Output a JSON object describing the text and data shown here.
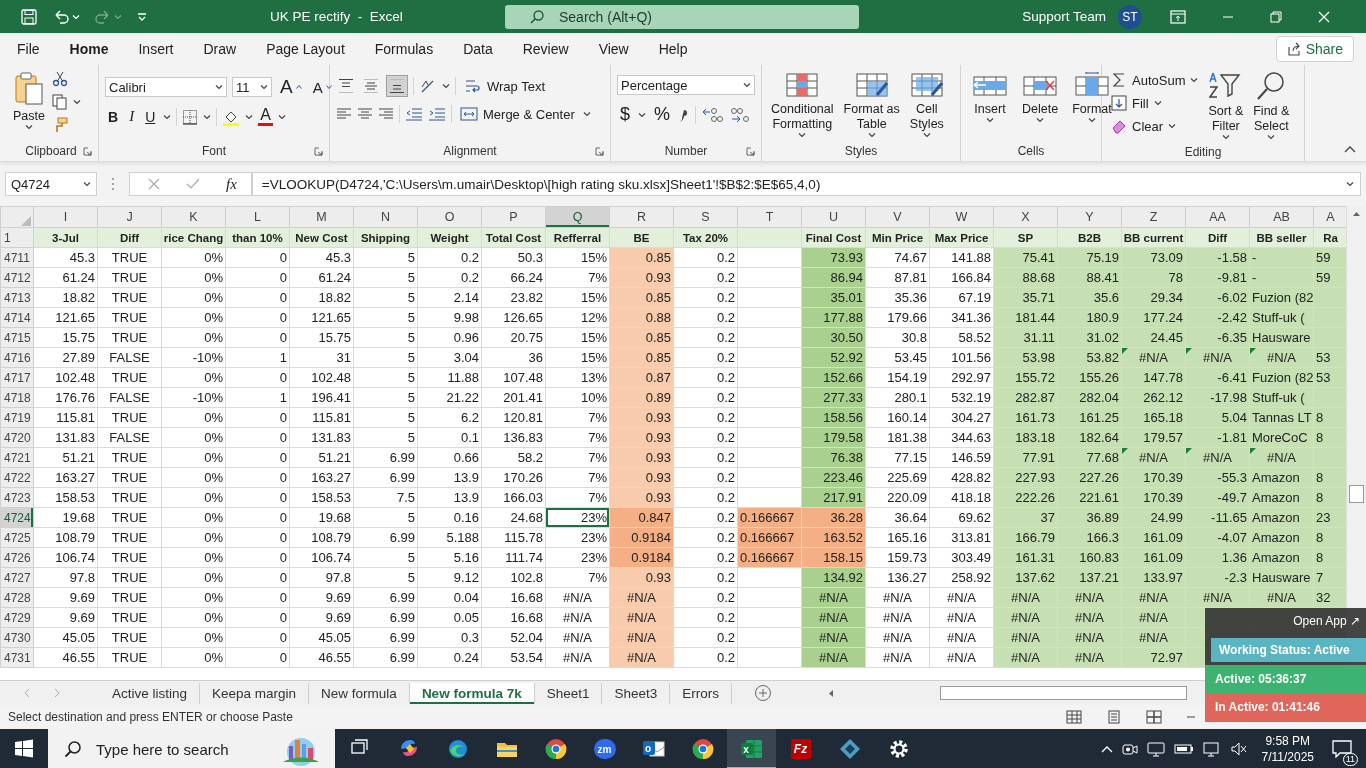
{
  "window": {
    "title": "UK PE rectify  -  Excel",
    "search_placeholder": "Search (Alt+Q)",
    "user_name": "Support Team",
    "avatar": "ST"
  },
  "quick_access": [
    {
      "kind": "save",
      "disabled": false
    },
    {
      "kind": "undo",
      "disabled": false
    },
    {
      "kind": "redo",
      "disabled": true
    },
    {
      "kind": "customize",
      "disabled": false
    }
  ],
  "menu_tabs": [
    {
      "label": "File",
      "selected": false
    },
    {
      "label": "Home",
      "selected": true
    },
    {
      "label": "Insert",
      "selected": false
    },
    {
      "label": "Draw",
      "selected": false
    },
    {
      "label": "Page Layout",
      "selected": false
    },
    {
      "label": "Formulas",
      "selected": false
    },
    {
      "label": "Data",
      "selected": false
    },
    {
      "label": "Review",
      "selected": false
    },
    {
      "label": "View",
      "selected": false
    },
    {
      "label": "Help",
      "selected": false
    }
  ],
  "share": "Share",
  "ribbon": {
    "clipboard": {
      "paste": "Paste",
      "label": "Clipboard"
    },
    "font": {
      "name": "Calibri",
      "size": "11",
      "grow": "A",
      "shrink": "A",
      "bold": "B",
      "italic": "I",
      "underline": "U",
      "font_color": "A",
      "label": "Font"
    },
    "alignment": {
      "vertical_align": [
        {
          "kind": "top",
          "selected": false
        },
        {
          "kind": "middle",
          "selected": false
        },
        {
          "kind": "bottom",
          "selected": true
        }
      ],
      "wrap": "Wrap Text",
      "merge": "Merge & Center",
      "label": "Alignment"
    },
    "number": {
      "format": "Percentage",
      "currency": "$",
      "percent": "%",
      "label": "Number"
    },
    "styles": {
      "conditional": "Conditional\nFormatting",
      "format_table": "Format as\nTable",
      "cell_styles": "Cell\nStyles",
      "label": "Styles"
    },
    "cells": {
      "insert": "Insert",
      "delete": "Delete",
      "format": "Format",
      "label": "Cells"
    },
    "editing": {
      "autosum": "AutoSum",
      "fill": "Fill",
      "clear": "Clear",
      "sort": "Sort &\nFilter",
      "find": "Find &\nSelect",
      "label": "Editing"
    }
  },
  "formula_bar": {
    "name_box": "Q4724",
    "function_label": "fx",
    "formula": "=VLOOKUP(D4724,'C:\\Users\\m.umair\\Desktop\\[high rating sku.xlsx]Sheet1'!$B$2:$E$65,4,0)"
  },
  "grid": {
    "header_row": "1",
    "columns": [
      {
        "letter": "I",
        "title": "3-Jul",
        "kind": "number",
        "selected": false
      },
      {
        "letter": "J",
        "title": "Diff",
        "kind": "boolean",
        "selected": false
      },
      {
        "letter": "K",
        "title": "rice Chang",
        "kind": "number",
        "selected": false
      },
      {
        "letter": "L",
        "title": "than 10%",
        "kind": "number",
        "selected": false
      },
      {
        "letter": "M",
        "title": "New Cost",
        "kind": "number",
        "selected": false
      },
      {
        "letter": "N",
        "title": "Shipping",
        "kind": "number",
        "selected": false
      },
      {
        "letter": "O",
        "title": "Weight",
        "kind": "number",
        "selected": false
      },
      {
        "letter": "P",
        "title": "Total Cost",
        "kind": "number",
        "selected": false
      },
      {
        "letter": "Q",
        "title": "Refferral",
        "kind": "number",
        "selected": true
      },
      {
        "letter": "R",
        "title": "BE",
        "kind": "number",
        "selected": false,
        "color": "#f8cbad",
        "flaggable": true
      },
      {
        "letter": "S",
        "title": "Tax 20%",
        "kind": "number",
        "selected": false
      },
      {
        "letter": "T",
        "kind": "text",
        "selected": false,
        "flaggable": true
      },
      {
        "letter": "U",
        "title": "Final Cost",
        "kind": "number",
        "selected": false,
        "color": "#a9d08e",
        "flaggable": true
      },
      {
        "letter": "V",
        "title": "Min Price",
        "kind": "number",
        "selected": false
      },
      {
        "letter": "W",
        "title": "Max Price",
        "kind": "number",
        "selected": false
      },
      {
        "letter": "X",
        "title": "SP",
        "kind": "number",
        "selected": false,
        "color": "#c6e0b4"
      },
      {
        "letter": "Y",
        "title": "B2B",
        "kind": "number",
        "selected": false,
        "color": "#c6e0b4"
      },
      {
        "letter": "Z",
        "title": "BB current",
        "kind": "number",
        "selected": false,
        "color": "#c6e0b4",
        "error_marks": true
      },
      {
        "letter": "AA",
        "title": "Diff",
        "kind": "number",
        "selected": false,
        "color": "#c6e0b4",
        "error_marks": true
      },
      {
        "letter": "AB",
        "title": "BB seller",
        "kind": "text",
        "selected": false,
        "color": "#c6e0b4",
        "error_marks": true
      },
      {
        "letter": "A",
        "title": "Ra",
        "kind": "text",
        "selected": false,
        "color": "#c6e0b4"
      }
    ],
    "rows": [
      {
        "number": "4711",
        "selected": false,
        "flagged": false,
        "error_marks": false,
        "cells": [
          "45.3",
          "TRUE",
          "0%",
          "0",
          "45.3",
          "5",
          "0.2",
          "50.3",
          "15%",
          "0.85",
          "0.2",
          null,
          "73.93",
          "74.67",
          "141.88",
          "75.41",
          "75.19",
          "73.09",
          "-1.58",
          "-",
          "59"
        ]
      },
      {
        "number": "4712",
        "selected": false,
        "flagged": false,
        "error_marks": false,
        "cells": [
          "61.24",
          "TRUE",
          "0%",
          "0",
          "61.24",
          "5",
          "0.2",
          "66.24",
          "7%",
          "0.93",
          "0.2",
          null,
          "86.94",
          "87.81",
          "166.84",
          "88.68",
          "88.41",
          "78",
          "-9.81",
          "-",
          "59"
        ]
      },
      {
        "number": "4713",
        "selected": false,
        "flagged": false,
        "error_marks": false,
        "cells": [
          "18.82",
          "TRUE",
          "0%",
          "0",
          "18.82",
          "5",
          "2.14",
          "23.82",
          "15%",
          "0.85",
          "0.2",
          null,
          "35.01",
          "35.36",
          "67.19",
          "35.71",
          "35.6",
          "29.34",
          "-6.02",
          "Fuzion (82",
          null
        ]
      },
      {
        "number": "4714",
        "selected": false,
        "flagged": false,
        "error_marks": false,
        "cells": [
          "121.65",
          "TRUE",
          "0%",
          "0",
          "121.65",
          "5",
          "9.98",
          "126.65",
          "12%",
          "0.88",
          "0.2",
          null,
          "177.88",
          "179.66",
          "341.36",
          "181.44",
          "180.9",
          "177.24",
          "-2.42",
          "Stuff-uk (",
          null
        ]
      },
      {
        "number": "4715",
        "selected": false,
        "flagged": false,
        "error_marks": false,
        "cells": [
          "15.75",
          "TRUE",
          "0%",
          "0",
          "15.75",
          "5",
          "0.96",
          "20.75",
          "15%",
          "0.85",
          "0.2",
          null,
          "30.50",
          "30.8",
          "58.52",
          "31.11",
          "31.02",
          "24.45",
          "-6.35",
          "Hausware",
          null
        ]
      },
      {
        "number": "4716",
        "selected": false,
        "flagged": false,
        "error_marks": true,
        "cells": [
          "27.89",
          "FALSE",
          "-10%",
          "1",
          "31",
          "5",
          "3.04",
          "36",
          "15%",
          "0.85",
          "0.2",
          null,
          "52.92",
          "53.45",
          "101.56",
          "53.98",
          "53.82",
          {
            "text": "#N/A",
            "kind": "error"
          },
          {
            "text": "#N/A",
            "kind": "error"
          },
          {
            "text": "#N/A",
            "kind": "error"
          },
          "53"
        ]
      },
      {
        "number": "4717",
        "selected": false,
        "flagged": false,
        "error_marks": false,
        "cells": [
          "102.48",
          "TRUE",
          "0%",
          "0",
          "102.48",
          "5",
          "11.88",
          "107.48",
          "13%",
          "0.87",
          "0.2",
          null,
          "152.66",
          "154.19",
          "292.97",
          "155.72",
          "155.26",
          "147.78",
          "-6.41",
          "Fuzion (82",
          "53"
        ]
      },
      {
        "number": "4718",
        "selected": false,
        "flagged": false,
        "error_marks": false,
        "cells": [
          "176.76",
          "FALSE",
          "-10%",
          "1",
          "196.41",
          "5",
          "21.22",
          "201.41",
          "10%",
          "0.89",
          "0.2",
          null,
          "277.33",
          "280.1",
          "532.19",
          "282.87",
          "282.04",
          "262.12",
          "-17.98",
          "Stuff-uk (",
          null
        ]
      },
      {
        "number": "4719",
        "selected": false,
        "flagged": false,
        "error_marks": false,
        "cells": [
          "115.81",
          "TRUE",
          "0%",
          "0",
          "115.81",
          "5",
          "6.2",
          "120.81",
          "7%",
          "0.93",
          "0.2",
          null,
          "158.56",
          "160.14",
          "304.27",
          "161.73",
          "161.25",
          "165.18",
          "5.04",
          "Tannas LT",
          "8"
        ]
      },
      {
        "number": "4720",
        "selected": false,
        "flagged": false,
        "error_marks": false,
        "cells": [
          "131.83",
          "FALSE",
          "0%",
          "0",
          "131.83",
          "5",
          "0.1",
          "136.83",
          "7%",
          "0.93",
          "0.2",
          null,
          "179.58",
          "181.38",
          "344.63",
          "183.18",
          "182.64",
          "179.57",
          "-1.81",
          "MoreCoC",
          "8"
        ]
      },
      {
        "number": "4721",
        "selected": false,
        "flagged": false,
        "error_marks": true,
        "cells": [
          "51.21",
          "TRUE",
          "0%",
          "0",
          "51.21",
          "6.99",
          "0.66",
          "58.2",
          "7%",
          "0.93",
          "0.2",
          null,
          "76.38",
          "77.15",
          "146.59",
          "77.91",
          "77.68",
          {
            "text": "#N/A",
            "kind": "error"
          },
          {
            "text": "#N/A",
            "kind": "error"
          },
          {
            "text": "#N/A",
            "kind": "error"
          },
          null
        ]
      },
      {
        "number": "4722",
        "selected": false,
        "flagged": false,
        "error_marks": false,
        "cells": [
          "163.27",
          "TRUE",
          "0%",
          "0",
          "163.27",
          "6.99",
          "13.9",
          "170.26",
          "7%",
          "0.93",
          "0.2",
          null,
          "223.46",
          "225.69",
          "428.82",
          "227.93",
          "227.26",
          "170.39",
          "-55.3",
          "Amazon",
          "8"
        ]
      },
      {
        "number": "4723",
        "selected": false,
        "flagged": false,
        "error_marks": false,
        "cells": [
          "158.53",
          "TRUE",
          "0%",
          "0",
          "158.53",
          "7.5",
          "13.9",
          "166.03",
          "7%",
          "0.93",
          "0.2",
          null,
          "217.91",
          "220.09",
          "418.18",
          "222.26",
          "221.61",
          "170.39",
          "-49.7",
          "Amazon",
          "8"
        ]
      },
      {
        "number": "4724",
        "selected": true,
        "flagged": true,
        "error_marks": false,
        "cells": [
          "19.68",
          "TRUE",
          "0%",
          "0",
          "19.68",
          "5",
          "0.16",
          "24.68",
          "23%",
          "0.847",
          "0.2",
          "0.166667",
          "36.28",
          "36.64",
          "69.62",
          "37",
          "36.89",
          "24.99",
          "-11.65",
          "Amazon",
          "23"
        ]
      },
      {
        "number": "4725",
        "selected": false,
        "flagged": true,
        "error_marks": false,
        "cells": [
          "108.79",
          "TRUE",
          "0%",
          "0",
          "108.79",
          "6.99",
          "5.188",
          "115.78",
          "23%",
          "0.9184",
          "0.2",
          "0.166667",
          "163.52",
          "165.16",
          "313.81",
          "166.79",
          "166.3",
          "161.09",
          "-4.07",
          "Amazon",
          "8"
        ]
      },
      {
        "number": "4726",
        "selected": false,
        "flagged": true,
        "error_marks": false,
        "cells": [
          "106.74",
          "TRUE",
          "0%",
          "0",
          "106.74",
          "5",
          "5.16",
          "111.74",
          "23%",
          "0.9184",
          "0.2",
          "0.166667",
          "158.15",
          "159.73",
          "303.49",
          "161.31",
          "160.83",
          "161.09",
          "1.36",
          "Amazon",
          "8"
        ]
      },
      {
        "number": "4727",
        "selected": false,
        "flagged": false,
        "error_marks": false,
        "cells": [
          "97.8",
          "TRUE",
          "0%",
          "0",
          "97.8",
          "5",
          "9.12",
          "102.8",
          "7%",
          "0.93",
          "0.2",
          null,
          "134.92",
          "136.27",
          "258.92",
          "137.62",
          "137.21",
          "133.97",
          "-2.3",
          "Hausware",
          "7"
        ]
      },
      {
        "number": "4728",
        "selected": false,
        "flagged": false,
        "error_marks": false,
        "cells": [
          "9.69",
          "TRUE",
          "0%",
          "0",
          "9.69",
          "6.99",
          "0.04",
          "16.68",
          {
            "text": "#N/A",
            "kind": "error"
          },
          {
            "text": "#N/A",
            "kind": "error"
          },
          "0.2",
          null,
          {
            "text": "#N/A",
            "kind": "error"
          },
          {
            "text": "#N/A",
            "kind": "error"
          },
          {
            "text": "#N/A",
            "kind": "error"
          },
          {
            "text": "#N/A",
            "kind": "error"
          },
          {
            "text": "#N/A",
            "kind": "error"
          },
          {
            "text": "#N/A",
            "kind": "error"
          },
          {
            "text": "#N/A",
            "kind": "error"
          },
          {
            "text": "#N/A",
            "kind": "error"
          },
          "32"
        ]
      },
      {
        "number": "4729",
        "selected": false,
        "flagged": false,
        "error_marks": false,
        "cells": [
          "9.69",
          "TRUE",
          "0%",
          "0",
          "9.69",
          "6.99",
          "0.05",
          "16.68",
          {
            "text": "#N/A",
            "kind": "error"
          },
          {
            "text": "#N/A",
            "kind": "error"
          },
          "0.2",
          null,
          {
            "text": "#N/A",
            "kind": "error"
          },
          {
            "text": "#N/A",
            "kind": "error"
          },
          {
            "text": "#N/A",
            "kind": "error"
          },
          {
            "text": "#N/A",
            "kind": "error"
          },
          {
            "text": "#N/A",
            "kind": "error"
          },
          {
            "text": "#N/A",
            "kind": "error"
          },
          null,
          null,
          null
        ]
      },
      {
        "number": "4730",
        "selected": false,
        "flagged": false,
        "error_marks": false,
        "cells": [
          "45.05",
          "TRUE",
          "0%",
          "0",
          "45.05",
          "6.99",
          "0.3",
          "52.04",
          {
            "text": "#N/A",
            "kind": "error"
          },
          {
            "text": "#N/A",
            "kind": "error"
          },
          "0.2",
          null,
          {
            "text": "#N/A",
            "kind": "error"
          },
          {
            "text": "#N/A",
            "kind": "error"
          },
          {
            "text": "#N/A",
            "kind": "error"
          },
          {
            "text": "#N/A",
            "kind": "error"
          },
          {
            "text": "#N/A",
            "kind": "error"
          },
          {
            "text": "#N/A",
            "kind": "error"
          },
          null,
          null,
          null
        ]
      },
      {
        "number": "4731",
        "selected": false,
        "flagged": false,
        "error_marks": false,
        "cells": [
          "46.55",
          "TRUE",
          "0%",
          "0",
          "46.55",
          "6.99",
          "0.24",
          "53.54",
          {
            "text": "#N/A",
            "kind": "error"
          },
          {
            "text": "#N/A",
            "kind": "error"
          },
          "0.2",
          null,
          {
            "text": "#N/A",
            "kind": "error"
          },
          {
            "text": "#N/A",
            "kind": "error"
          },
          {
            "text": "#N/A",
            "kind": "error"
          },
          {
            "text": "#N/A",
            "kind": "error"
          },
          {
            "text": "#N/A",
            "kind": "error"
          },
          "72.97",
          null,
          null,
          null
        ]
      }
    ]
  },
  "sheet_tabs": [
    {
      "label": "Active listing",
      "selected": false
    },
    {
      "label": "Keepa margin",
      "selected": false
    },
    {
      "label": "New formula",
      "selected": false
    },
    {
      "label": "New formula 7k",
      "selected": true
    },
    {
      "label": "Sheet1",
      "selected": false
    },
    {
      "label": "Sheet3",
      "selected": false
    },
    {
      "label": "Errors",
      "selected": false
    }
  ],
  "status_bar": {
    "message": "Select destination and press ENTER or choose Paste"
  },
  "tracker": {
    "open_app": "Open App ↗",
    "status": "Working Status: Active",
    "active": "Active: 05:36:37",
    "inactive": "In Active: 01:41:46"
  },
  "taskbar": {
    "search_placeholder": "Type here to search",
    "apps": [
      {
        "kind": "taskview",
        "selected": false
      },
      {
        "kind": "swirl",
        "selected": false
      },
      {
        "kind": "wave",
        "selected": false
      },
      {
        "kind": "folder",
        "selected": false
      },
      {
        "kind": "chrome",
        "selected": false
      },
      {
        "kind": "zoom",
        "label": "zm",
        "selected": false
      },
      {
        "kind": "mail",
        "label": "o",
        "selected": false
      },
      {
        "kind": "chrome",
        "selected": false
      },
      {
        "kind": "sheet",
        "label": "x",
        "selected": true
      },
      {
        "kind": "fz",
        "label": "Fz",
        "selected": false
      },
      {
        "kind": "diamond",
        "selected": false
      },
      {
        "kind": "gear",
        "selected": false
      }
    ],
    "time": "9:58 PM",
    "date": "7/11/2025",
    "notifications": "11"
  }
}
